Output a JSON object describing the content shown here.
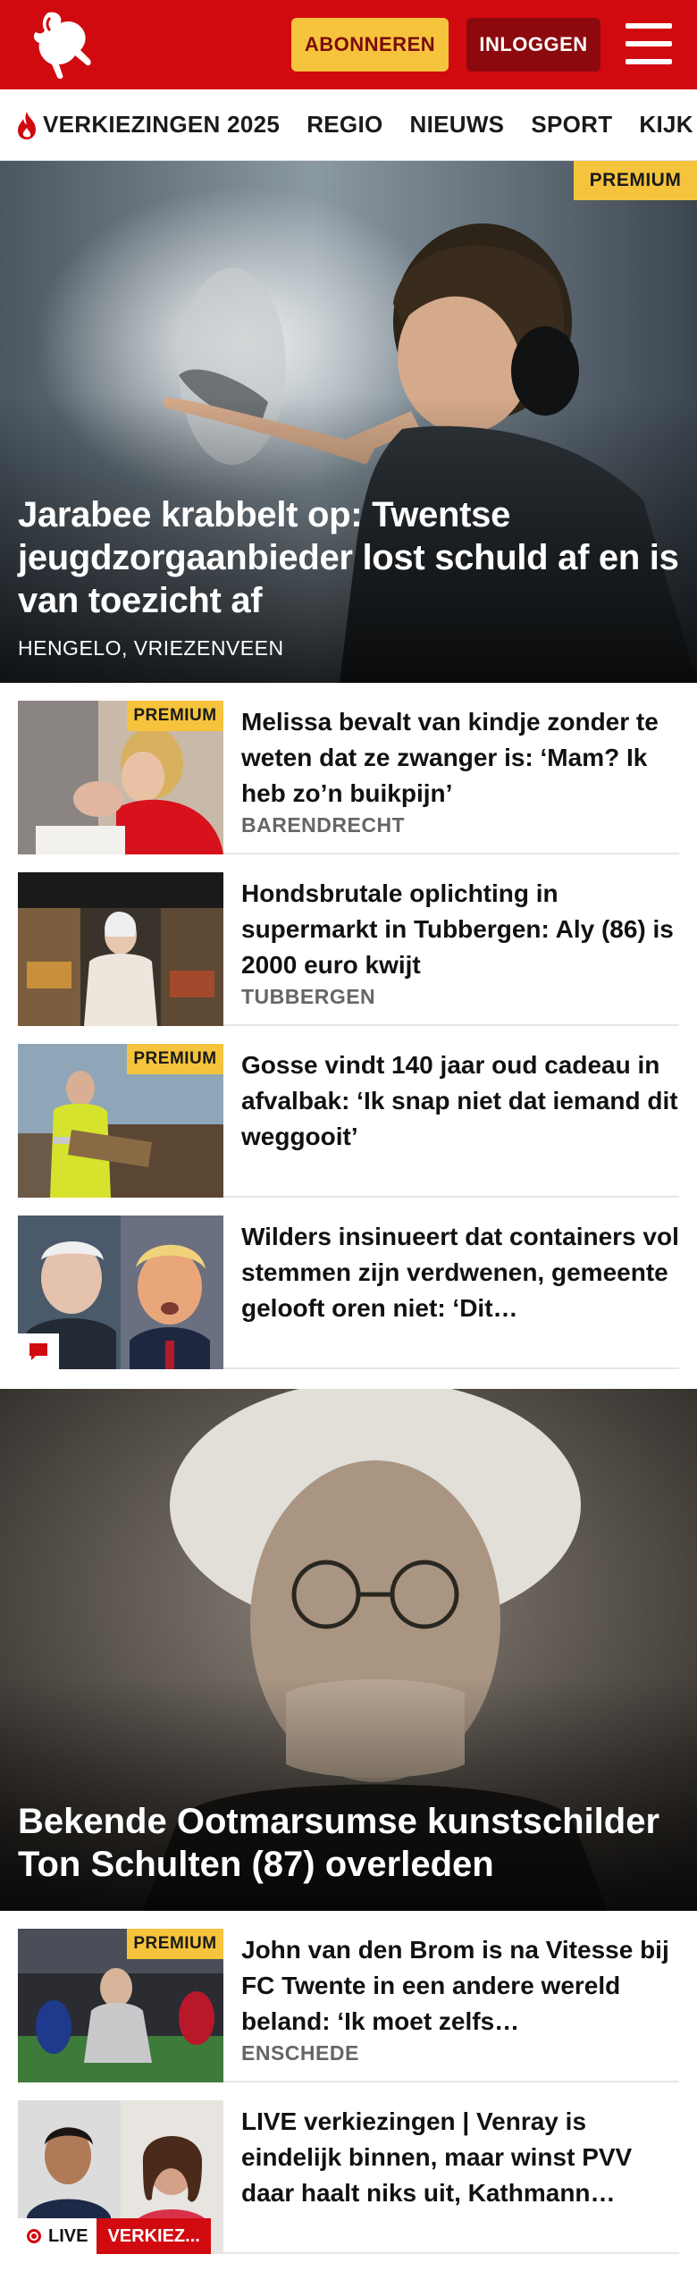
{
  "header": {
    "subscribe_label": "ABONNEREN",
    "login_label": "INLOGGEN",
    "brand_color": "#d10a10"
  },
  "nav": {
    "items": [
      "VERKIEZINGEN 2025",
      "REGIO",
      "NIEUWS",
      "SPORT",
      "KIJK"
    ]
  },
  "hero": {
    "badge": "PREMIUM",
    "title": "Jarabee krabbelt op: Twentse jeugdzorgaanbieder lost schuld af en is van toezicht af",
    "location": "HENGELO, VRIEZENVEEN"
  },
  "articles": [
    {
      "badge": "PREMIUM",
      "title": "Melissa bevalt van kindje zonder te weten dat ze zwanger is: ‘Mam? Ik heb zo’n buikpijn’",
      "location": "BARENDRECHT"
    },
    {
      "title": "Hondsbrutale oplichting in supermarkt in Tubbergen: Aly (86) is 2000 euro kwijt",
      "location": "TUBBERGEN"
    },
    {
      "badge": "PREMIUM",
      "title": "Gosse vindt 140 jaar oud cadeau in afvalbak: ‘Ik snap niet dat iemand dit weggooit’"
    },
    {
      "title": "Wilders insinueert dat containers vol stemmen zijn verdwenen, gemeente gelooft oren niet: ‘Dit…"
    }
  ],
  "feature": {
    "title": "Bekende Ootmarsumse kunstschilder Ton Schulten (87) overleden"
  },
  "articles2": [
    {
      "badge": "PREMIUM",
      "title": "John van den Brom is na Vitesse bij FC Twente in een andere wereld beland: ‘Ik moet zelfs…",
      "location": "ENSCHEDE"
    },
    {
      "title": "LIVE verkiezingen | Venray is eindelijk binnen, maar winst PVV daar haalt niks uit, Kathmann…",
      "live_label": "LIVE",
      "tag_label": "VERKIEZ..."
    }
  ]
}
